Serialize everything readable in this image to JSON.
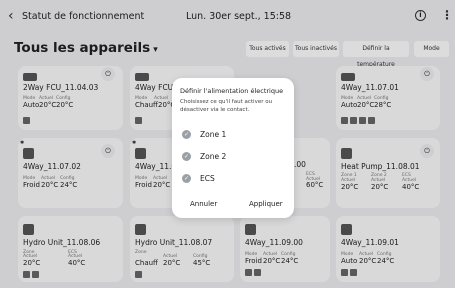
{
  "topbar": {
    "title": "Statut de fonctionnement",
    "datetime": "Lun. 30er sept., 15:58",
    "info_icon": "info-icon",
    "more_icon": "more-vert-icon"
  },
  "header": {
    "title": "Tous les appareils",
    "chevron": "▾"
  },
  "filters": [
    {
      "label": "Tous activés"
    },
    {
      "label": "Tous inactivés"
    },
    {
      "label": "Définir la température"
    },
    {
      "label": "Mode"
    }
  ],
  "cards": [
    {
      "name": "2Way FCU_11.04.03",
      "mode_label": "Mode",
      "actual_label": "Actuel",
      "config_label": "Config",
      "mode": "Auto",
      "actual": "20°C",
      "config": "20°C"
    },
    {
      "name": "4Way FCU_11",
      "mode_label": "Mode",
      "actual_label": "Actuel",
      "config_label": "Config",
      "mode": "Chauff",
      "actual": "20°C",
      "config": ""
    },
    {
      "name": "4Way_11.07.01",
      "mode_label": "Mode",
      "actual_label": "Actuel",
      "config_label": "Config",
      "mode": "Auto",
      "actual": "20°C",
      "config": "28°C"
    },
    {
      "name": "4Way_11.07.02",
      "mode_label": "Mode",
      "actual_label": "Actuel",
      "config_label": "Config",
      "mode": "Froid",
      "actual": "20°C",
      "config": "24°C"
    },
    {
      "name": "4Way_11.07.",
      "mode_label": "Mode",
      "actual_label": "Actuel",
      "config_label": "",
      "mode": "Froid",
      "actual": "20°C",
      "config": ""
    },
    {
      "name": ".00",
      "ecs_label": "ECS",
      "actual_label": "Actuel",
      "actual": "60°C"
    },
    {
      "name": "Heat Pump_11.08.01",
      "zone1_label": "Zone 1",
      "zone2_label": "Zone 2",
      "ecs_label": "ECS",
      "sub_label": "Actuel",
      "zone1": "20°C",
      "zone2": "20°C",
      "ecs": "40°C"
    },
    {
      "name": "Hydro Unit_11.08.06",
      "zone_label": "Zone",
      "ecs_label": "ECS",
      "sub_label": "Actuel",
      "zone": "20°C",
      "ecs": "40°C"
    },
    {
      "name": "Hydro Unit_11.08.07",
      "zone_label": "Zone",
      "mode_label": "Actuel",
      "config_label": "Config",
      "mode": "Chauff",
      "actual": "20°C",
      "config": "45°C"
    },
    {
      "name": "4Way_11.09.00",
      "mode_label": "Mode",
      "actual_label": "Actuel",
      "config_label": "Config",
      "mode": "Froid",
      "actual": "20°C",
      "config": "24°C"
    },
    {
      "name": "4Way_11.09.01",
      "mode_label": "Mode",
      "actual_label": "Actuel",
      "config_label": "Config",
      "mode": "Auto",
      "actual": "20°C",
      "config": "24°C"
    }
  ],
  "dialog": {
    "title": "Définir l'alimentation électrique",
    "description": "Choisissez ce qu'il faut activer ou désactiver via le contact.",
    "options": [
      {
        "label": "Zone 1",
        "checked": true
      },
      {
        "label": "Zone 2",
        "checked": true
      },
      {
        "label": "ECS",
        "checked": true
      }
    ],
    "cancel_label": "Annuler",
    "apply_label": "Appliquer"
  }
}
